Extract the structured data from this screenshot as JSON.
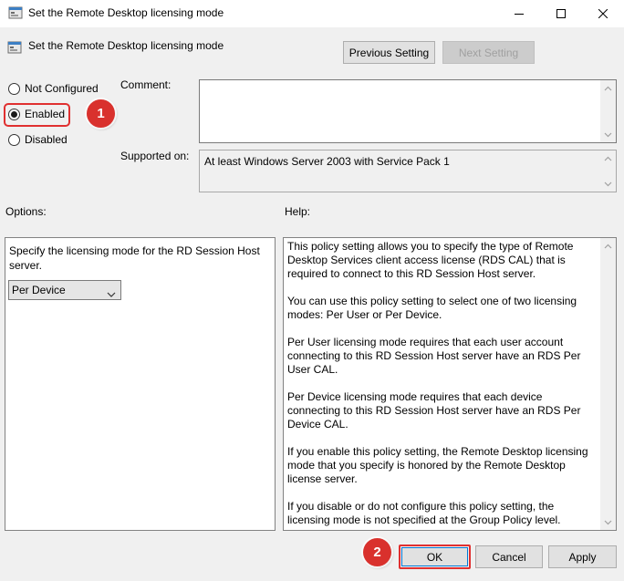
{
  "window": {
    "title": "Set the Remote Desktop licensing mode",
    "minimize_icon": "minimize-icon",
    "maximize_icon": "maximize-icon",
    "close_icon": "close-icon"
  },
  "header": {
    "policy_title": "Set the Remote Desktop licensing mode",
    "policy_icon": "policy-setting-icon",
    "previous_label": "Previous Setting",
    "next_label": "Next Setting"
  },
  "state": {
    "options": [
      {
        "label": "Not Configured",
        "checked": false
      },
      {
        "label": "Enabled",
        "checked": true
      },
      {
        "label": "Disabled",
        "checked": false
      }
    ]
  },
  "comment": {
    "label": "Comment:",
    "value": ""
  },
  "supported": {
    "label": "Supported on:",
    "value": "At least Windows Server 2003 with Service Pack 1"
  },
  "options_panel": {
    "label": "Options:",
    "description": "Specify the licensing mode for the RD Session Host server.",
    "mode_selected": "Per Device"
  },
  "help_panel": {
    "label": "Help:",
    "paragraphs": [
      "This policy setting allows you to specify the type of Remote Desktop Services client access license (RDS CAL) that is required to connect to this RD Session Host server.",
      "You can use this policy setting to select one of two licensing modes: Per User or Per Device.",
      "Per User licensing mode requires that each user account connecting to this RD Session Host server have an RDS Per User CAL.",
      "Per Device licensing mode requires that each device connecting to this RD Session Host server have an RDS Per Device CAL.",
      "If you enable this policy setting, the Remote Desktop licensing mode that you specify is honored by the Remote Desktop license server.",
      "If you disable or do not configure this policy setting, the licensing mode is not specified at the Group Policy level."
    ]
  },
  "footer": {
    "ok_label": "OK",
    "cancel_label": "Cancel",
    "apply_label": "Apply"
  },
  "annotations": {
    "step1": "1",
    "step2": "2",
    "highlight_color": "#e03030",
    "badge_color": "#d9312d"
  }
}
